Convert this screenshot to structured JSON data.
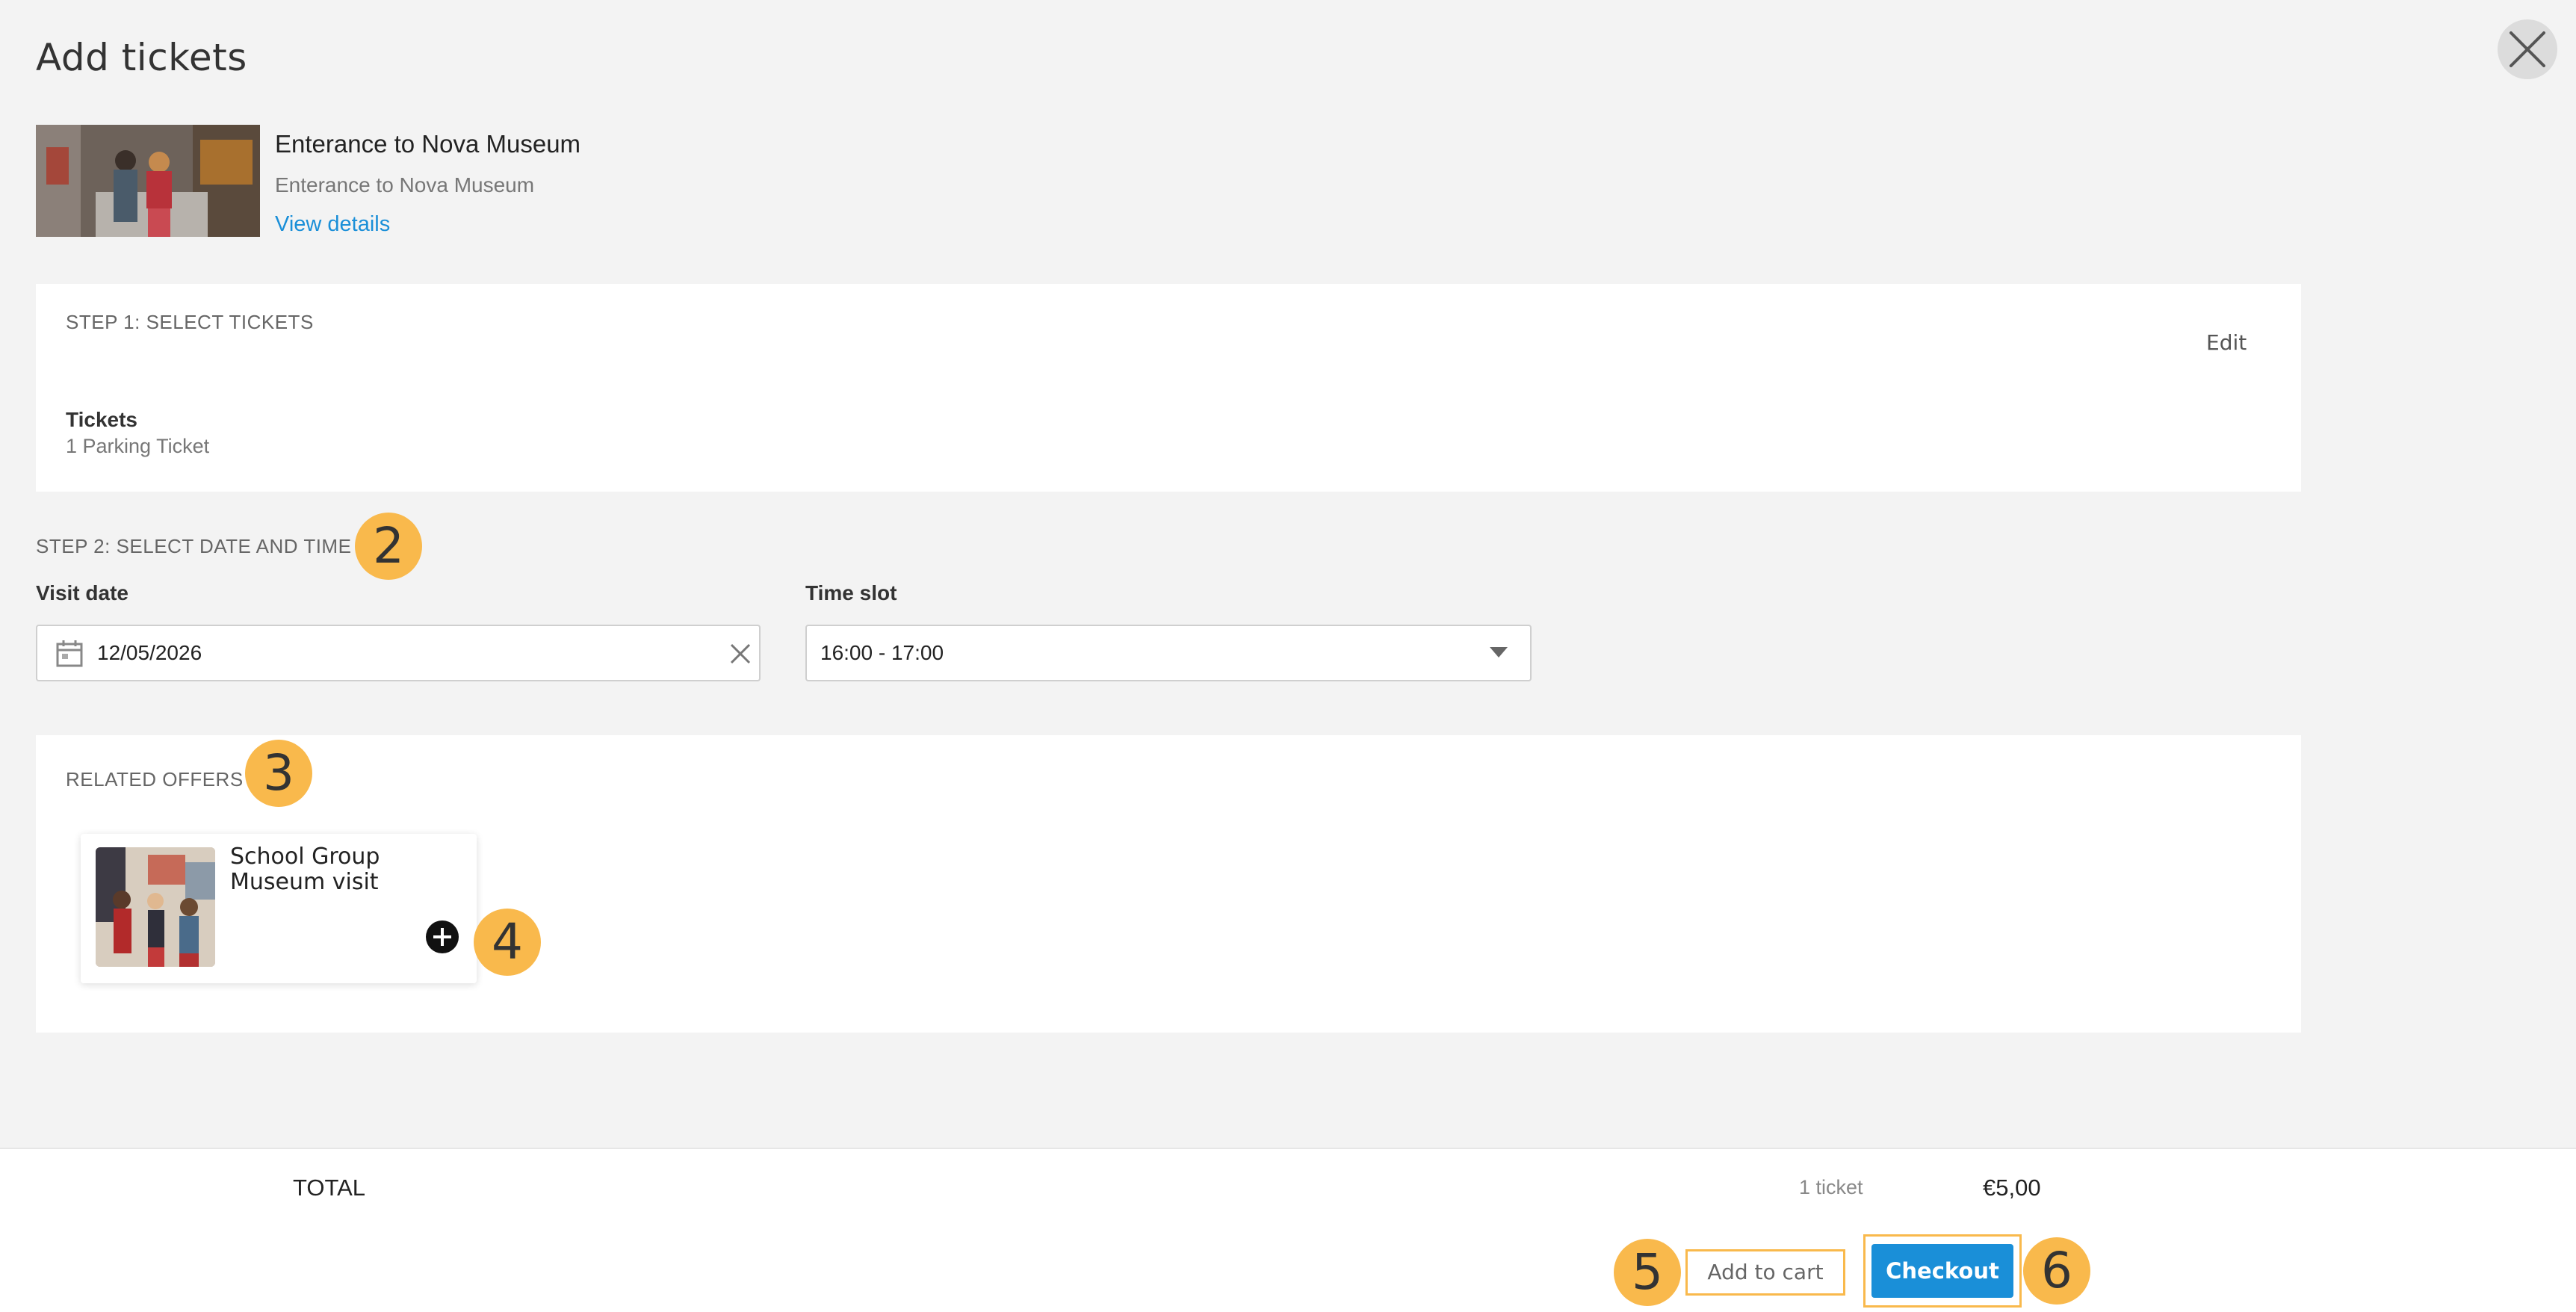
{
  "dialog": {
    "title": "Add tickets",
    "close_icon": "close-icon"
  },
  "product": {
    "title": "Enterance to Nova Museum",
    "subtitle": "Enterance to Nova Museum",
    "view_details": "View details"
  },
  "step1": {
    "label": "STEP 1: SELECT TICKETS",
    "edit": "Edit",
    "tickets_label": "Tickets",
    "tickets_value": "1 Parking Ticket"
  },
  "step2": {
    "label": "STEP 2: SELECT DATE AND TIME",
    "visit_date_label": "Visit date",
    "visit_date_value": "12/05/2026",
    "time_slot_label": "Time slot",
    "time_slot_value": "16:00 - 17:00"
  },
  "related": {
    "label": "RELATED OFFERS",
    "offers": [
      {
        "title": "School Group Museum visit"
      }
    ]
  },
  "footer": {
    "total_label": "TOTAL",
    "ticket_count": "1 ticket",
    "price": "€5,00",
    "add_to_cart": "Add to cart",
    "checkout": "Checkout"
  },
  "badges": {
    "b2": "2",
    "b3": "3",
    "b4": "4",
    "b5": "5",
    "b6": "6"
  },
  "colors": {
    "accent": "#1a8fd8",
    "badge": "#f9b94c",
    "background": "#f3f3f3"
  }
}
